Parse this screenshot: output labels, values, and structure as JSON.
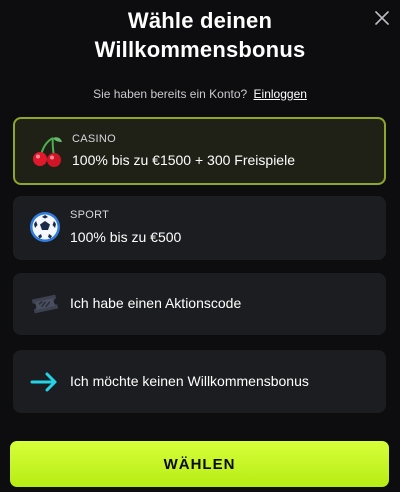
{
  "header": {
    "title_line1": "Wähle deinen",
    "title_line2": "Willkommensbonus"
  },
  "login": {
    "prompt": "Sie haben bereits ein Konto?",
    "link": "Einloggen"
  },
  "options": [
    {
      "category": "CASINO",
      "text": "100% bis zu €1500 + 300 Freispiele",
      "icon": "cherries-icon",
      "selected": true
    },
    {
      "category": "SPORT",
      "text": "100% bis zu €500",
      "icon": "soccer-ball-icon",
      "selected": false
    },
    {
      "category": "",
      "text": "Ich habe einen Aktionscode",
      "icon": "ticket-icon",
      "selected": false
    },
    {
      "category": "",
      "text": "Ich möchte keinen Willkommensbonus",
      "icon": "arrow-right-icon",
      "selected": false
    }
  ],
  "cta": {
    "label": "WÄHLEN"
  },
  "colors": {
    "background": "#0d0d0f",
    "card": "#1c1d21",
    "selected_border": "#8ea62a",
    "cta": "#c6f524",
    "arrow": "#23d3e6"
  }
}
